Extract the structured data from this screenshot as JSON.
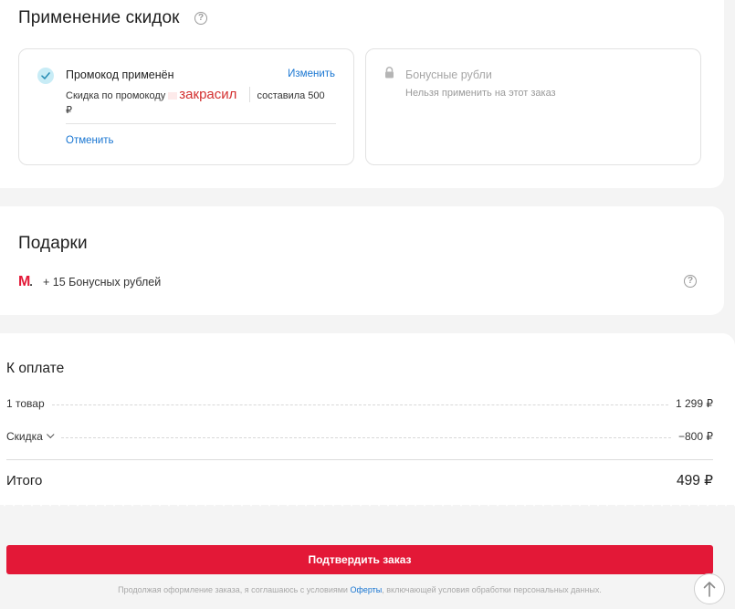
{
  "discounts": {
    "title": "Применение скидок",
    "promo": {
      "title": "Промокод применён",
      "change_label": "Изменить",
      "desc_prefix": "Скидка по промокоду",
      "code": "закрасил",
      "desc_suffix": "составила 500",
      "currency": "₽",
      "cancel_label": "Отменить"
    },
    "bonus": {
      "title": "Бонусные рубли",
      "desc": "Нельзя применить на этот заказ"
    }
  },
  "gifts": {
    "title": "Подарки",
    "logo_letter": "M",
    "logo_dot": ".",
    "item": "+ 15 Бонусных рублей"
  },
  "payment": {
    "title": "К оплате",
    "rows": [
      {
        "label": "1 товар",
        "value": "1 299 ₽"
      },
      {
        "label": "Скидка",
        "value": "−800 ₽"
      }
    ],
    "total_label": "Итого",
    "total_value": "499 ₽"
  },
  "confirm_label": "Подтвердить заказ",
  "terms": {
    "prefix": "Продолжая оформление заказа, я соглашаюсь с условиями",
    "link": "Оферты",
    "suffix": ", включающей условия обработки персональных данных."
  },
  "colors": {
    "accent": "#e31837",
    "link": "#1976d2",
    "check_bg": "#c8ecf6"
  },
  "icons": [
    "help-icon",
    "check-icon",
    "lock-icon",
    "chevron-down-icon",
    "arrow-up-icon"
  ]
}
